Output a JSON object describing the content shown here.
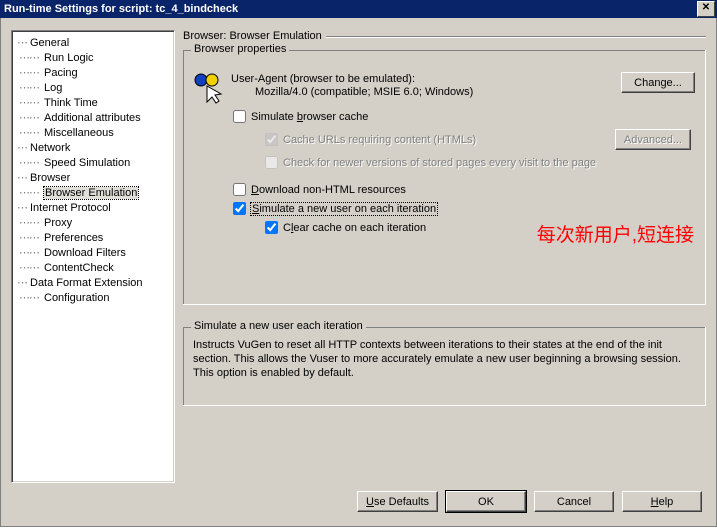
{
  "window": {
    "title": "Run-time Settings for script: tc_4_bindcheck",
    "close": "✕"
  },
  "tree": {
    "general": "General",
    "general_children": [
      "Run Logic",
      "Pacing",
      "Log",
      "Think Time",
      "Additional attributes",
      "Miscellaneous"
    ],
    "network": "Network",
    "network_children": [
      "Speed Simulation"
    ],
    "browser": "Browser",
    "browser_children": [
      "Browser Emulation"
    ],
    "internet": "Internet Protocol",
    "internet_children": [
      "Proxy",
      "Preferences",
      "Download Filters",
      "ContentCheck"
    ],
    "dfe": "Data Format Extension",
    "dfe_children": [
      "Configuration"
    ]
  },
  "right": {
    "header": "Browser: Browser Emulation",
    "group": "Browser properties",
    "ua_label": "User-Agent (browser to be emulated):",
    "ua_value": "Mozilla/4.0 (compatible; MSIE 6.0; Windows)",
    "change_btn": "Change...",
    "simulate_cache_pre": "Simulate ",
    "simulate_cache_accel": "b",
    "simulate_cache_post": "rowser cache",
    "cache_urls": "Cache URLs requiring content (HTMLs)",
    "advanced_btn": "Advanced...",
    "check_newer": "Check for newer versions of stored pages every visit to the page",
    "download_pre": "",
    "download_accel": "D",
    "download_post": "ownload non-HTML resources",
    "sim_new_user_pre": "",
    "sim_new_user_accel": "S",
    "sim_new_user_post": "imulate a new user on each iteration",
    "clear_cache_pre": "C",
    "clear_cache_accel": "l",
    "clear_cache_post": "ear cache on each iteration",
    "info_title": "Simulate a new user each iteration",
    "info_body": "Instructs VuGen to reset all HTTP contexts between iterations to their states at the end of the init section. This allows the Vuser to more accurately emulate a new user beginning a browsing session. This option is enabled by default."
  },
  "annotation": "每次新用户,短连接",
  "buttons": {
    "use_defaults_pre": "",
    "use_defaults_accel": "U",
    "use_defaults_post": "se Defaults",
    "ok": "OK",
    "cancel": "Cancel",
    "help_pre": "",
    "help_accel": "H",
    "help_post": "elp"
  }
}
